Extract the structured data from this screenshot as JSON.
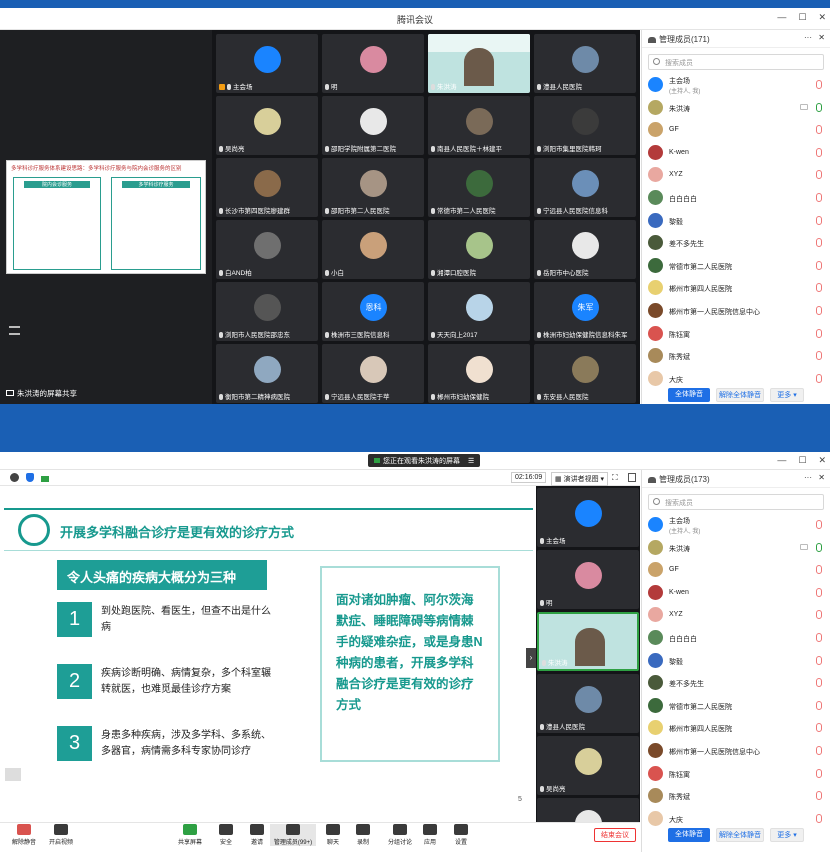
{
  "top": {
    "title": "腾讯会议",
    "slide_thumb_title": "多学科诊疗服务体系建设思路：多学科诊疗服务与院内会诊服务的区别",
    "slide_thumb_left": "院内会诊服务",
    "slide_thumb_right": "多学科诊疗服务",
    "share_label": "朱洪涛的屏幕共享",
    "tiles": [
      {
        "name": "主会场",
        "avatar": "#1a84ff",
        "host": true
      },
      {
        "name": "明",
        "avatar": "#d98aa0"
      },
      {
        "name": "朱洪涛",
        "avatar": "#4aa3a8",
        "host": false,
        "video": true
      },
      {
        "name": "澧县人民医院",
        "avatar": "#6e8aa8"
      },
      {
        "name": "吴尚亮",
        "avatar": "#d8cf9a"
      },
      {
        "name": "邵阳学院附属第二医院",
        "avatar": "#e8e8e8"
      },
      {
        "name": "南县人民医院＋林建平",
        "avatar": "#7a6a58"
      },
      {
        "name": "浏阳市集里医院韩珂",
        "avatar": "#3b3b3b"
      },
      {
        "name": "长沙市第四医院廖建群",
        "avatar": "#8a6a4a"
      },
      {
        "name": "邵阳市第二人民医院",
        "avatar": "#a69484"
      },
      {
        "name": "常德市第二人民医院",
        "avatar": "#3c6a3c"
      },
      {
        "name": "宁远县人民医院信息科",
        "avatar": "#6b8fb8"
      },
      {
        "name": "白AND柏",
        "avatar": "#6f6f6f"
      },
      {
        "name": "小白",
        "avatar": "#c9a07a"
      },
      {
        "name": "湘潭口腔医院",
        "avatar": "#a7c48a"
      },
      {
        "name": "岳阳市中心医院",
        "avatar": "#e8e8e8"
      },
      {
        "name": "浏阳市人民医院邵忠东",
        "avatar": "#555"
      },
      {
        "name": "株洲市三医院信息科",
        "avatar": "#1a84ff",
        "text": "恩科"
      },
      {
        "name": "天天向上2017",
        "avatar": "#b8d4e8"
      },
      {
        "name": "株洲市妇幼保健院信息科朱军",
        "avatar": "#1a84ff",
        "text": "朱军"
      },
      {
        "name": "衡阳市第二精神病医院",
        "avatar": "#8fa8c0"
      },
      {
        "name": "宁远县人民医院于苹",
        "avatar": "#d8c8b8"
      },
      {
        "name": "郴州市妇幼保健院",
        "avatar": "#f0e0d0"
      },
      {
        "name": "东安县人民医院",
        "avatar": "#8a7a5a"
      }
    ],
    "members_title": "管理成员(171)",
    "search_placeholder": "搜索成员",
    "members": [
      {
        "name": "主会场",
        "sub": "(主持人, 我)",
        "avatar": "#1a84ff",
        "on": false
      },
      {
        "name": "朱洪涛",
        "avatar": "#b5a862",
        "on": true
      },
      {
        "name": "GF",
        "avatar": "#caa36a"
      },
      {
        "name": "K-wen",
        "avatar": "#b33a3a"
      },
      {
        "name": "XYZ",
        "avatar": "#e9a8a0"
      },
      {
        "name": "白白白白",
        "avatar": "#5a8a5a"
      },
      {
        "name": "黎毅",
        "avatar": "#3a6abf"
      },
      {
        "name": "差不多先生",
        "avatar": "#4a5a3a"
      },
      {
        "name": "常德市第二人民医院",
        "avatar": "#3c6a3c"
      },
      {
        "name": "郴州市第四人民医院",
        "avatar": "#e8d070"
      },
      {
        "name": "郴州市第一人民医院信息中心",
        "avatar": "#7a4a2a"
      },
      {
        "name": "陈钰寓",
        "avatar": "#d9534f"
      },
      {
        "name": "陈秀斌",
        "avatar": "#a88a5a"
      },
      {
        "name": "大庆",
        "avatar": "#e8c8a8"
      }
    ],
    "mute_all": "全体静音",
    "unmute_all": "解除全体静音",
    "more": "更多"
  },
  "bottom": {
    "status": "您正在观看朱洪涛的屏幕",
    "timer": "02:16:09",
    "view_mode": "演讲者视图",
    "slide_title": "开展多学科融合诊疗是更有效的诊疗方式",
    "slide_banner": "令人头痛的疾病大概分为三种",
    "items": [
      {
        "num": "1",
        "text": "到处跑医院、看医生，但查不出是什么病"
      },
      {
        "num": "2",
        "text": "疾病诊断明确、病情复杂，多个科室辗转就医，也难觅最佳诊疗方案"
      },
      {
        "num": "3",
        "text": "身患多种疾病，涉及多学科、多系统、多器官，病情需多科专家协同诊疗"
      }
    ],
    "callout": "面对诸如肿瘤、阿尔茨海默症、睡眠障碍等病情棘手的疑难杂症，或是身患N种病的患者，开展多学科融合诊疗是更有效的诊疗方式",
    "page": "5",
    "side_tiles": [
      {
        "name": "主会场",
        "avatar": "#1a84ff"
      },
      {
        "name": "明",
        "avatar": "#d98aa0"
      },
      {
        "name": "朱洪涛",
        "avatar": "#4aa3a8"
      },
      {
        "name": "澧县人民医院",
        "avatar": "#6e8aa8"
      },
      {
        "name": "吴尚亮",
        "avatar": "#d8cf9a"
      },
      {
        "name": "",
        "avatar": "#e8e8e8"
      }
    ],
    "members_title": "管理成员(173)",
    "toolbar": [
      "解除静音",
      "开启视频",
      "共享屏幕",
      "安全",
      "邀请",
      "管理成员(99+)",
      "聊天",
      "录制",
      "分组讨论",
      "应用",
      "设置"
    ],
    "end": "结束会议"
  }
}
